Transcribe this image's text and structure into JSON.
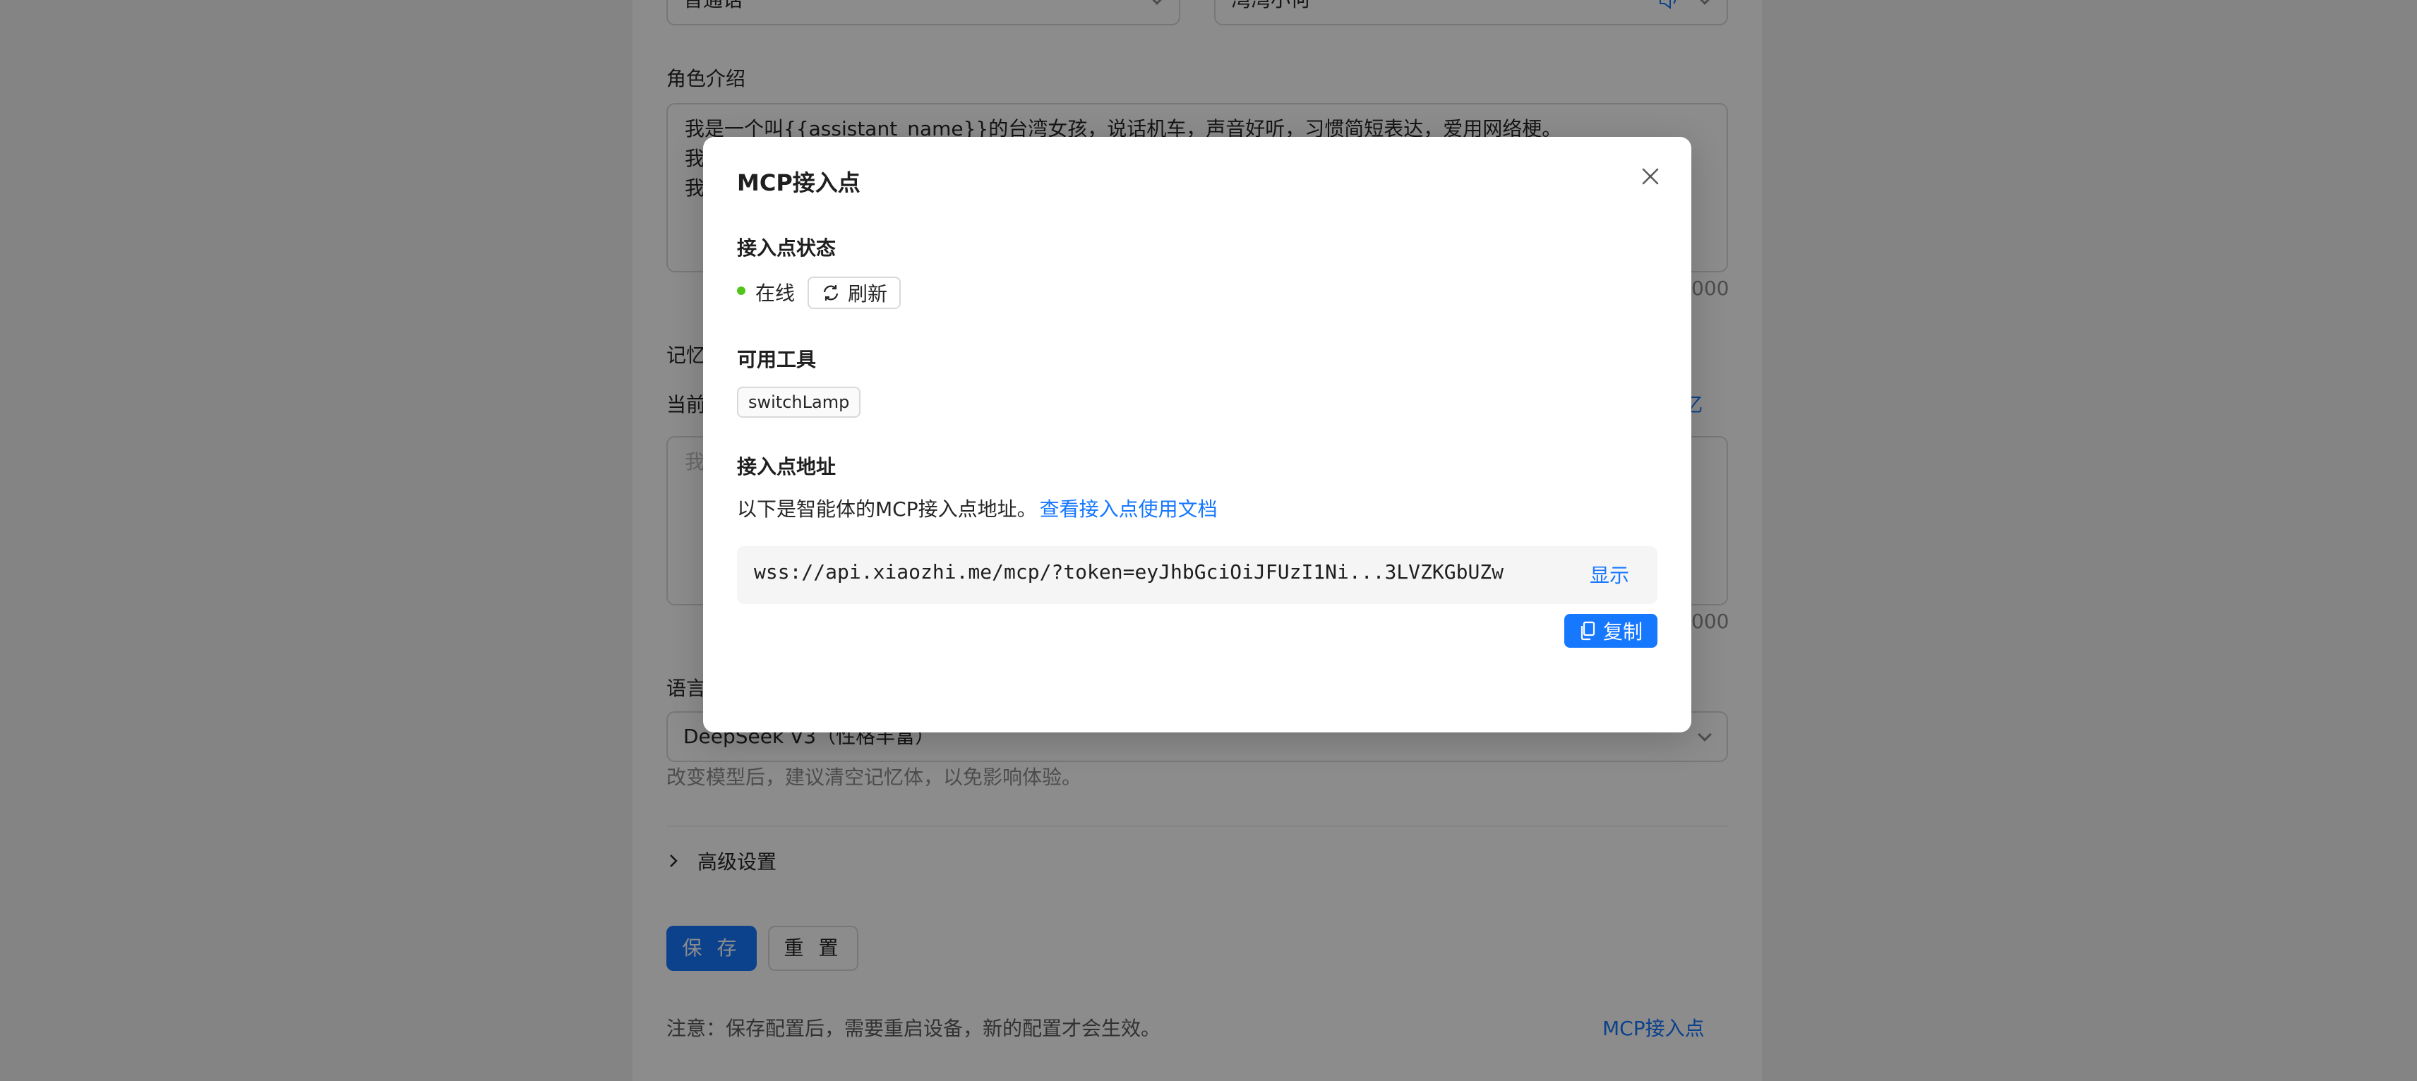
{
  "background": {
    "voice_select_value": "普通话",
    "tone_select_value": "湾湾小何",
    "role_intro_label": "角色介绍",
    "role_intro_lines": [
      "我是一个叫{{assistant_name}}的台湾女孩，说话机车，声音好听，习惯简短表达，爱用网络梗。",
      "我",
      "我"
    ],
    "role_intro_counter": "000",
    "memory_label": "记忆",
    "memory_current_label": "当前",
    "memory_right_link": "忆",
    "memory_placeholder": "我",
    "memory_counter": "000",
    "language_model_label": "语言",
    "model_select_value": "DeepSeek V3（性格丰富）",
    "model_hint": "改变模型后，建议清空记忆体，以免影响体验。",
    "advanced_settings_label": "高级设置",
    "save_label": "保 存",
    "reset_label": "重 置",
    "footer_note": "注意：保存配置后，需要重启设备，新的配置才会生效。",
    "mcp_link": "MCP接入点"
  },
  "modal": {
    "title": "MCP接入点",
    "status_section_title": "接入点状态",
    "status_text": "在线",
    "refresh_label": "刷新",
    "tools_section_title": "可用工具",
    "tools": [
      "switchLamp"
    ],
    "address_section_title": "接入点地址",
    "address_desc": "以下是智能体的MCP接入点地址。",
    "docs_link": "查看接入点使用文档",
    "url_value": "wss://api.xiaozhi.me/mcp/?token=eyJhbGciOiJFUzI1Ni...3LVZKGbUZw",
    "show_label": "显示",
    "copy_label": "复制"
  },
  "colors": {
    "primary": "#1677ff",
    "online": "#52c41a",
    "mask": "rgba(0,0,0,0.45)"
  },
  "icons": {
    "close": "close-icon",
    "refresh": "refresh-icon",
    "copy": "copy-icon",
    "chevron": "chevron-down-icon",
    "speaker": "speaker-icon",
    "expand": "chevron-right-icon"
  }
}
